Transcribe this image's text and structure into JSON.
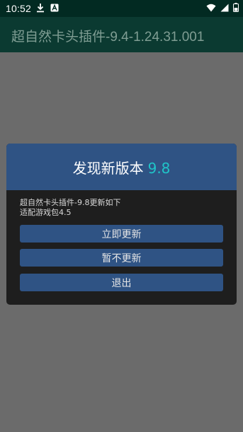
{
  "statusbar": {
    "time": "10:52",
    "icons": [
      "download-icon",
      "text-app-icon",
      "wifi-icon",
      "signal-icon",
      "battery-icon"
    ]
  },
  "appbar": {
    "title": "超自然卡头插件-9.4-1.24.31.001"
  },
  "dialog": {
    "title": "发现新版本",
    "version": "9.8",
    "message_lines": [
      "超自然卡头插件-9.8更新如下",
      "适配游戏包4.5"
    ],
    "buttons": {
      "update": "立即更新",
      "skip": "暂不更新",
      "exit": "退出"
    }
  },
  "colors": {
    "statusbar_bg": "#022a22",
    "appbar_bg": "#0b3a31",
    "overlay_bg": "#6b6b6b",
    "dialog_bg": "#1e1e1e",
    "accent_blue": "#2f5384",
    "version_teal": "#20c4c8"
  }
}
